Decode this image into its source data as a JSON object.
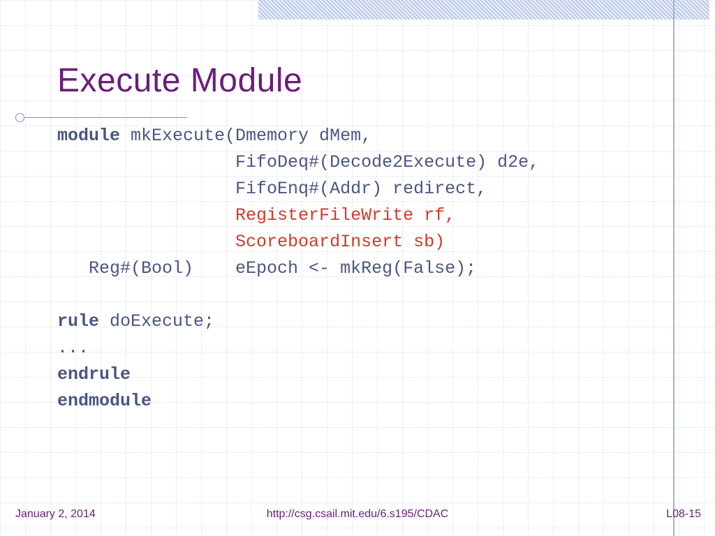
{
  "title": "Execute Module",
  "code": {
    "l1_kw": "module",
    "l1_rest": " mkExecute(Dmemory dMem,",
    "l2": "                 FifoDeq#(Decode2Execute) d2e,",
    "l3": "                 FifoEnq#(Addr) redirect,",
    "l4": "                 RegisterFileWrite rf,",
    "l5": "                 ScoreboardInsert sb)",
    "l6": "   Reg#(Bool)    eEpoch <- mkReg(False);",
    "blank1": " ",
    "l7_kw": "rule",
    "l7_rest": " doExecute;",
    "l8": "...",
    "l9": "endrule",
    "l10": "endmodule"
  },
  "footer": {
    "date": "January 2, 2014",
    "url": "http://csg.csail.mit.edu/6.s195/CDAC",
    "page": "L08-15"
  }
}
